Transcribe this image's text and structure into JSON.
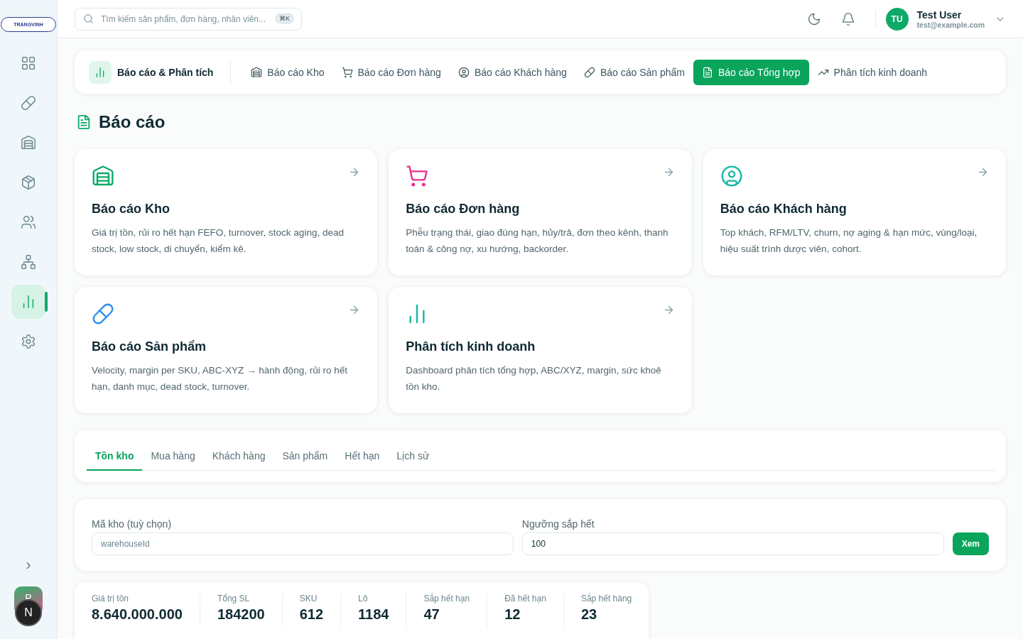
{
  "logo": {
    "text": "TRANGVINH"
  },
  "sidebar": {
    "items": [
      {
        "selected": false
      },
      {
        "selected": false
      },
      {
        "selected": false
      },
      {
        "selected": false
      },
      {
        "selected": false
      },
      {
        "selected": false
      },
      {
        "selected": true
      },
      {
        "selected": false
      }
    ],
    "expand": "›",
    "workspace": "P",
    "dev_badge": "N"
  },
  "header": {
    "search": {
      "placeholder": "Tìm kiếm sản phẩm, đơn hàng, nhân viên...",
      "shortcut": "⌘K"
    },
    "user": {
      "initials": "TU",
      "name": "Test User",
      "email": "test@example.com"
    }
  },
  "report_nav": {
    "title": "Báo cáo & Phân tích",
    "items": [
      {
        "label": "Báo cáo Kho",
        "selected": false
      },
      {
        "label": "Báo cáo Đơn hàng",
        "selected": false
      },
      {
        "label": "Báo cáo Khách hàng",
        "selected": false
      },
      {
        "label": "Báo cáo Sản phẩm",
        "selected": false
      },
      {
        "label": "Báo cáo Tổng hợp",
        "selected": true
      },
      {
        "label": "Phân tích kinh doanh",
        "selected": false
      }
    ]
  },
  "page_title": "Báo cáo",
  "cards": [
    {
      "title": "Báo cáo Kho",
      "description": "Giá trị tồn, rủi ro hết hạn FEFO, turnover, stock aging, dead stock, low stock, di chuyển, kiểm kê.",
      "color": "#0fa968"
    },
    {
      "title": "Báo cáo Đơn hàng",
      "description": "Phễu trạng thái, giao đúng hạn, hủy/trả, đơn theo kênh, thanh toán & công nợ, xu hướng, backorder.",
      "color": "#ec2f8c"
    },
    {
      "title": "Báo cáo Khách hàng",
      "description": "Top khách, RFM/LTV, churn, nợ aging & hạn mức, vùng/loại, hiệu suất trình dược viên, cohort.",
      "color": "#14b8a6"
    },
    {
      "title": "Báo cáo Sản phẩm",
      "description": "Velocity, margin per SKU, ABC-XYZ → hành động, rủi ro hết hạn, danh mục, dead stock, turnover.",
      "color": "#2f8ff0"
    },
    {
      "title": "Phân tích kinh doanh",
      "description": "Dashboard phân tích tổng hợp, ABC/XYZ, margin, sức khoẻ tồn kho.",
      "color": "#14b8a6"
    }
  ],
  "tabs": [
    {
      "label": "Tồn kho",
      "selected": true
    },
    {
      "label": "Mua hàng",
      "selected": false
    },
    {
      "label": "Khách hàng",
      "selected": false
    },
    {
      "label": "Sản phẩm",
      "selected": false
    },
    {
      "label": "Hết hạn",
      "selected": false
    },
    {
      "label": "Lịch sử",
      "selected": false
    }
  ],
  "filters": {
    "warehouse": {
      "label": "Mã kho (tuỳ chọn)",
      "placeholder": "warehouseId"
    },
    "threshold": {
      "label": "Ngưỡng sắp hết",
      "value": "100"
    },
    "button": "Xem"
  },
  "stats": [
    {
      "label": "Giá trị tồn",
      "value": "8.640.000.000"
    },
    {
      "label": "Tổng SL",
      "value": "184200"
    },
    {
      "label": "SKU",
      "value": "612"
    },
    {
      "label": "Lô",
      "value": "1184"
    },
    {
      "label": "Sắp hết hạn",
      "value": "47"
    },
    {
      "label": "Đã hết hạn",
      "value": "12"
    },
    {
      "label": "Sắp hết hàng",
      "value": "23"
    }
  ]
}
